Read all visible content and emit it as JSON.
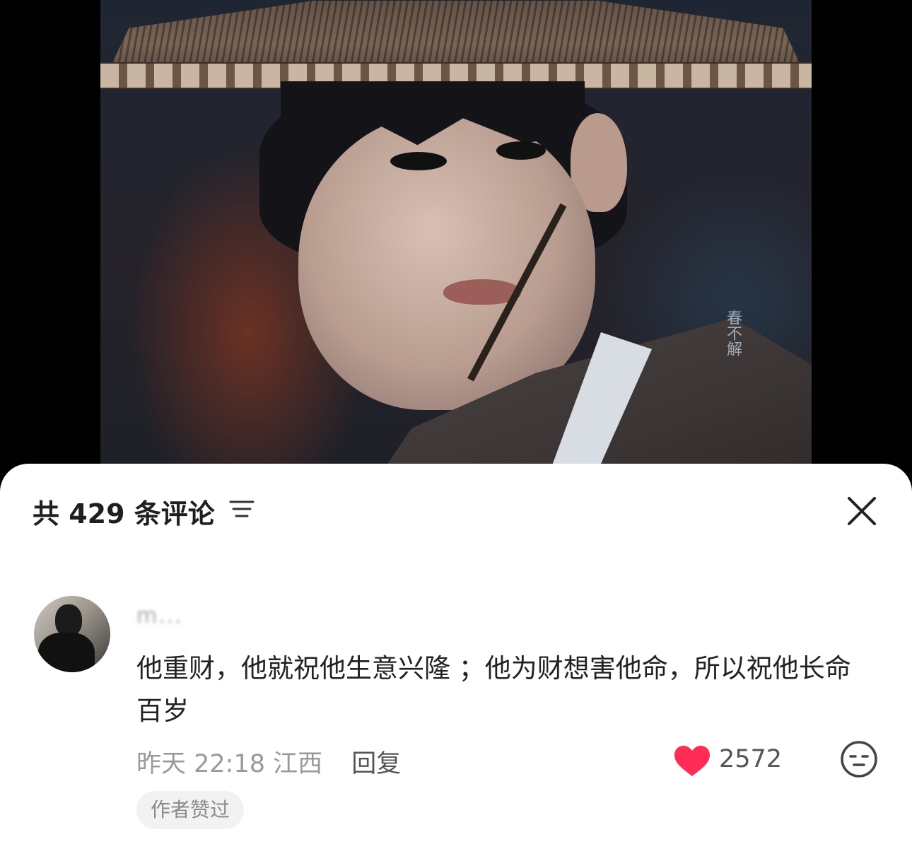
{
  "video": {
    "watermark_text": "春不解"
  },
  "comments_panel": {
    "count_label": "共 429 条评论",
    "sort_icon": "sort-filter-icon",
    "close_icon": "close-icon"
  },
  "comment": {
    "username": "m...",
    "text": "他重财，他就祝他生意兴隆 ；他为财想害他命，所以祝他长命百岁",
    "time": "昨天 22:18",
    "location": "江西",
    "reply_label": "回复",
    "like_count": "2572",
    "like_icon": "heart-icon",
    "like_color": "#ff2d55",
    "emoji_icon": "emoji-face-icon",
    "badge": "作者赞过"
  }
}
